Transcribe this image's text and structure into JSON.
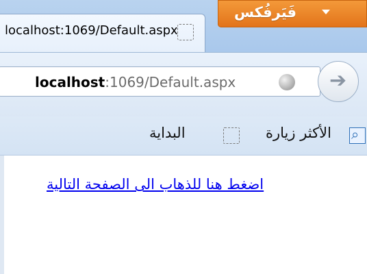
{
  "browser": {
    "menu_button_label": "فَيَرفُكس",
    "tab": {
      "title": "localhost:1069/Default.aspx"
    },
    "url": {
      "host": "localhost",
      "rest": ":1069/Default.aspx"
    },
    "bookmarks": [
      {
        "label": "الأكثر زيارة",
        "icon": "most-visited-icon"
      },
      {
        "label": "البداية",
        "icon": "page-icon"
      }
    ]
  },
  "page": {
    "link_text": "اضغط هنا للذهاب الى الصفحة التالية"
  },
  "colors": {
    "menu_button": "#e2731a",
    "link": "#0000ee",
    "chrome": "#dbe7f5"
  }
}
